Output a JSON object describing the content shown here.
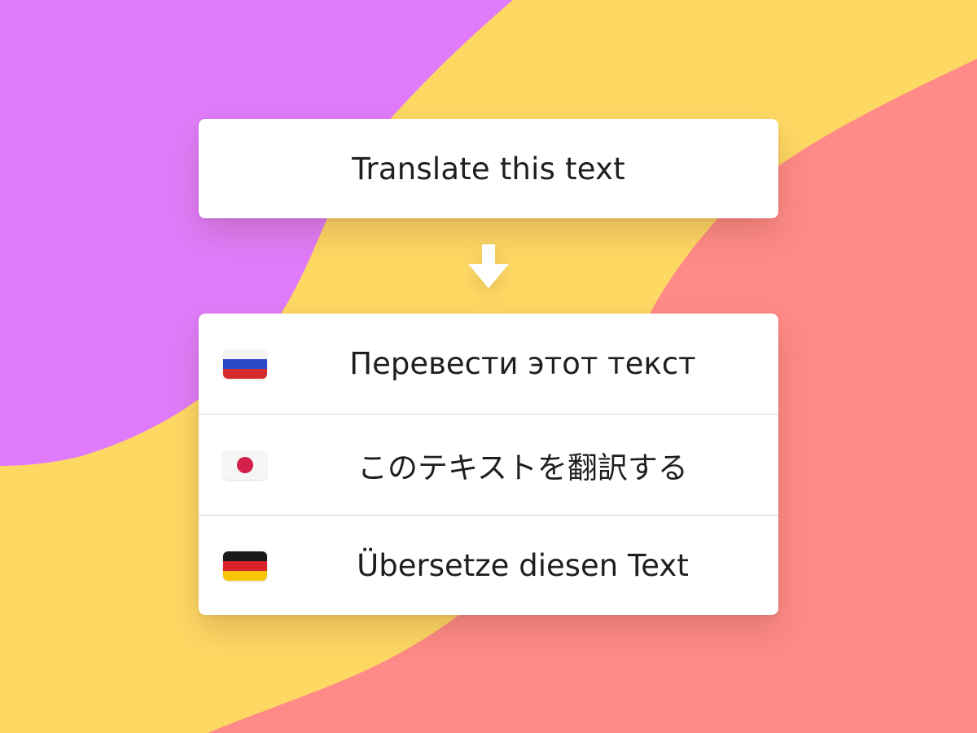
{
  "colors": {
    "purple": "#E07CFB",
    "yellow": "#FDD964",
    "coral": "#FF8A87",
    "card": "#FFFFFF",
    "text": "#1F1F1F"
  },
  "source": {
    "text": "Translate this text"
  },
  "arrow": {
    "icon": "arrow-down-icon"
  },
  "translations": [
    {
      "flag_icon": "russia-flag-icon",
      "text": "Перевести этот текст"
    },
    {
      "flag_icon": "japan-flag-icon",
      "text": "このテキストを翻訳する"
    },
    {
      "flag_icon": "germany-flag-icon",
      "text": "Übersetze diesen Text"
    }
  ]
}
